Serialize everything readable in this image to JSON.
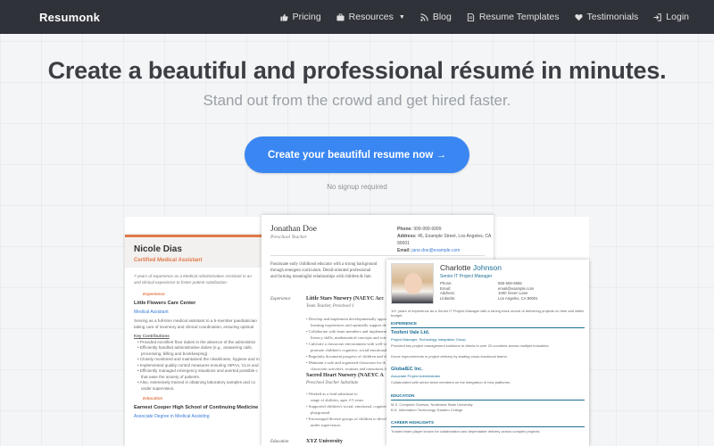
{
  "nav": {
    "brand": "Resumonk",
    "items": [
      {
        "label": "Pricing",
        "icon": "thumbs-up-icon"
      },
      {
        "label": "Resources",
        "icon": "briefcase-icon"
      },
      {
        "label": "Blog",
        "icon": "rss-icon"
      },
      {
        "label": "Resume Templates",
        "icon": "document-icon"
      },
      {
        "label": "Testimonials",
        "icon": "heart-icon"
      },
      {
        "label": "Login",
        "icon": "login-icon"
      }
    ]
  },
  "hero": {
    "title": "Create a beautiful and professional résumé in minutes.",
    "subtitle": "Stand out from the crowd and get hired faster.",
    "cta": "Create your beautiful resume now →",
    "note": "No signup required"
  },
  "colors": {
    "nav_bg": "#2f3238",
    "cta": "#3a86f2",
    "accent_orange": "#e07a49",
    "accent_teal": "#1b6e95"
  },
  "previews": {
    "left": {
      "name": "Nicole Dias",
      "role": "Certified Medical Assistant",
      "intro1": "7 years of experience as a Medical Administrative Assistant in an",
      "intro2": "and clinical experience to foster patient satisfaction.",
      "section1": "Experience",
      "employer": "Little Flowers Care Center",
      "job": "Medical Assistant",
      "desc1": "Serving as a full-time medical assistant to a 5-member paediatrician",
      "desc2": "taking care of inventory and clinical coordination, ensuring optimal",
      "contrib": "Key Contributions",
      "b1": "Provided excellent floor duties in the absence of the administrat",
      "b2": "Efficiently handled administrative duties (e.g., answering calls,",
      "b3": "processing, billing and bookkeeping).",
      "b4": "Closely monitored and maintained the cleanliness, hygiene and m",
      "b5": "Implemented quality control measures ensuring HIPAA, CLIA and",
      "b6": "Efficiently managed emergency situations and averted possible c",
      "b7": "that ease the anxiety of patients.",
      "b8": "Also, extensively trained in obtaining laboratory samples and co",
      "b9": "under supervision.",
      "section2": "Education",
      "school": "Earnest Cooper High School of Continuing Medicine",
      "degree": "Associate Degree in Medical Assisting"
    },
    "mid": {
      "name": "Jonathan Doe",
      "title": "Preschool Teacher",
      "phone_label": "Phone:",
      "phone": "999-999-9999",
      "address_label": "Address:",
      "address": "45, Example Street, Los Angeles, CA 90001",
      "email_label": "Email:",
      "email": "jane.doe@example.com",
      "summary1": "Passionate early childhood educator with a strong background",
      "summary2": "through emergent curriculum. Detail-oriented professional",
      "summary3": "and forming meaningful relationships with children & fam",
      "label1": "Experience",
      "job1": "Little Stars Nursery (NAEYC Acc",
      "job1sub": "Team Teacher, Preschool 1",
      "b1": "Develop and implement developmentally appropriate",
      "b2": "learning experiences and optimally support develop",
      "b3": "Collaborate with team members and implement emergent curr",
      "b4": "literacy skills, mathematical concepts and scientific",
      "b5": "Cultivate a classroom environment with well-struc",
      "b6": "promote children's cognitive, social-emotional and",
      "b7": "Regularly document progress of children and sha",
      "b8": "Maintain a safe and organized classroom for th",
      "b9": "classroom activities, routines and transitions for t",
      "job2": "Sacred Heart Nursery (NAEYC A",
      "job2sub": "Preschool Teacher Substitute",
      "c1": "Worked as a lead substitute to",
      "c2": "range of abilities, ages 2-5 years",
      "c3": "Supported children's social, emotional, cognitive an",
      "c4": "playground.",
      "c5": "Encouraged diverse groups of children to develop",
      "c6": "under supervision.",
      "label2": "Education",
      "school": "XYZ University"
    },
    "right": {
      "first": "Charlotte",
      "last": "Johnson",
      "role": "Senior IT Project Manager",
      "c1": "Phone:",
      "c2": "Email:",
      "c3": "Address:",
      "c4": "LinkedIn:",
      "v1": "555-555-5555",
      "v2": "email@example.com",
      "v3": "1000 Green Lane",
      "v4": "Los Angeles, CA 90001",
      "summary": "10+ years of experience as a Senior IT Project Manager with a strong track record of delivering projects on time and within budget.",
      "sec1": "EXPERIENCE",
      "co1": "Teofeni Vale Ltd.",
      "co1role": "Project Manager, Technology Integration Group",
      "co1b1": "Provided key project management solutions to clients in over 20 countries across multiple industries.",
      "co1b2": "Drove improvements in project delivery by leading cross-functional teams.",
      "co2": "GlobalEC Inc.",
      "co2role": "Associate Project Administrator",
      "co2b1": "Collaborated with senior team members on the integration of new platforms.",
      "sec2": "EDUCATION",
      "ed1": "M.S. Computer Science, Northwest State University",
      "ed2": "B.S. Information Technology, Eastern College",
      "sec3": "CAREER HIGHLIGHTS",
      "hl1": "Trusted team player known for collaboration and dependable delivery across complex projects."
    }
  }
}
